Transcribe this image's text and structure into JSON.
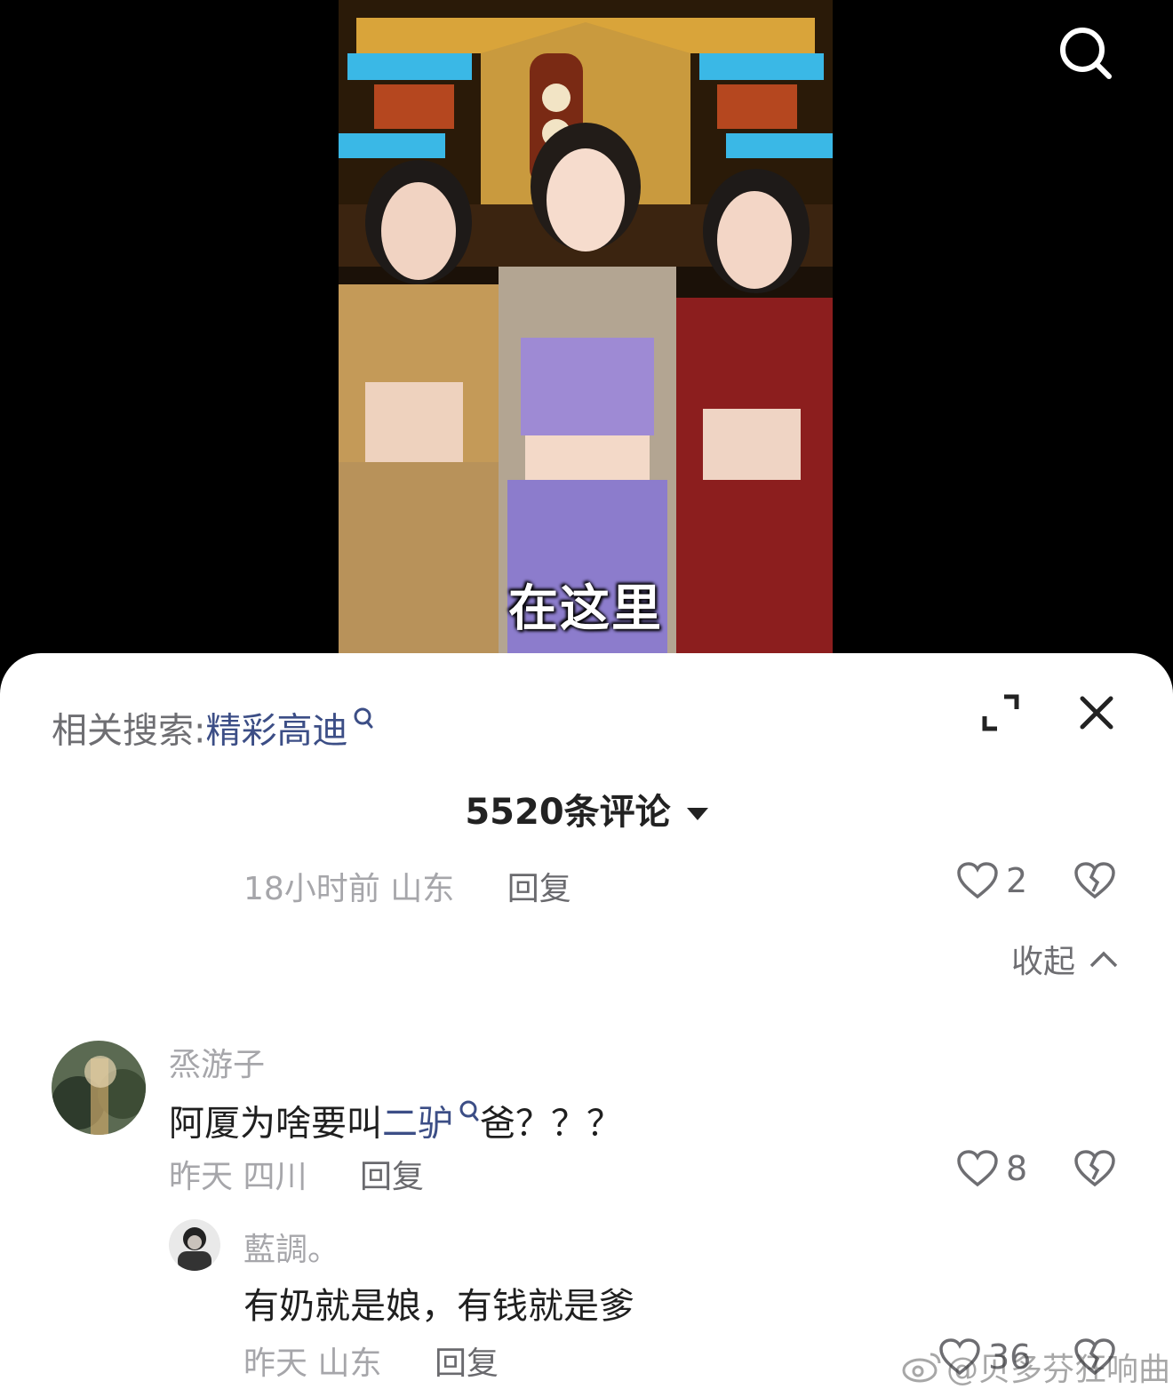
{
  "video": {
    "subtitle": "在这里"
  },
  "comments_panel": {
    "related_prefix": "相关搜索:",
    "related_keyword": "精彩高迪",
    "count_label": "5520条评论",
    "collapse_label": "收起",
    "prev_reply": {
      "time": "18小时前",
      "region": "山东",
      "reply_label": "回复",
      "likes": "2"
    },
    "comment": {
      "username": "烝游子",
      "text_before": "阿厦为啥要叫",
      "keyword": "二驴",
      "text_after": "爸？？？",
      "time": "昨天",
      "region": "四川",
      "reply_label": "回复",
      "likes": "8"
    },
    "reply": {
      "username": "藍調。",
      "text": "有奶就是娘，有钱就是爹",
      "time": "昨天",
      "region": "山东",
      "reply_label": "回复",
      "likes": "36"
    }
  },
  "watermark": "@贝多芬狂响曲",
  "colors": {
    "keyword": "#3c4e86",
    "meta": "#a6a6aa",
    "text": "#1f1f1f"
  }
}
